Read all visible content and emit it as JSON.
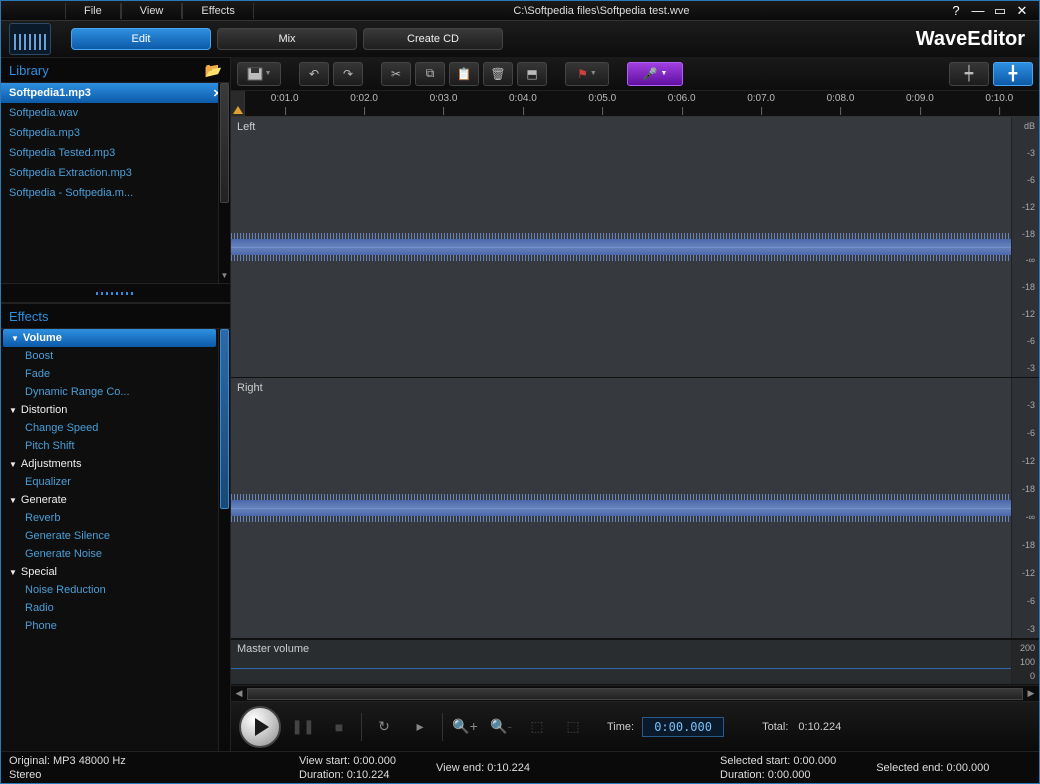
{
  "menubar": {
    "file": "File",
    "view": "View",
    "effects": "Effects",
    "title": "C:\\Softpedia files\\Softpedia test.wve"
  },
  "brand": "WaveEditor",
  "maintabs": {
    "edit": "Edit",
    "mix": "Mix",
    "create_cd": "Create CD"
  },
  "library": {
    "header": "Library",
    "items": [
      "Softpedia1.mp3",
      "Softpedia.wav",
      "Softpedia.mp3",
      "Softpedia Tested.mp3",
      "Softpedia Extraction.mp3",
      "Softpedia - Softpedia.m..."
    ]
  },
  "effects": {
    "header": "Effects",
    "tree": [
      {
        "cat": "Volume",
        "active": true,
        "children": [
          "Boost",
          "Fade",
          "Dynamic Range Co..."
        ]
      },
      {
        "cat": "Distortion",
        "children": [
          "Change Speed",
          "Pitch Shift"
        ]
      },
      {
        "cat": "Adjustments",
        "children": [
          "Equalizer"
        ]
      },
      {
        "cat": "Generate",
        "children": [
          "Reverb",
          "Generate Silence",
          "Generate Noise"
        ]
      },
      {
        "cat": "Special",
        "children": [
          "Noise Reduction",
          "Radio",
          "Phone"
        ]
      }
    ]
  },
  "ruler": {
    "ticks": [
      "0:01.0",
      "0:02.0",
      "0:03.0",
      "0:04.0",
      "0:05.0",
      "0:06.0",
      "0:07.0",
      "0:08.0",
      "0:09.0",
      "0:10.0"
    ]
  },
  "channels": {
    "left": "Left",
    "right": "Right",
    "db_header": "dB",
    "scale": [
      "-3",
      "-6",
      "-12",
      "-18",
      "-∞",
      "-18",
      "-12",
      "-6",
      "-3"
    ]
  },
  "master": {
    "label": "Master volume",
    "scale": [
      "200",
      "100",
      "0"
    ]
  },
  "transport": {
    "time_label": "Time:",
    "time_value": "0:00.000",
    "total_label": "Total:",
    "total_value": "0:10.224"
  },
  "status": {
    "original": "Original: MP3  48000 Hz",
    "stereo": "Stereo",
    "view_start": "View start: 0:00.000",
    "view_end": "View end: 0:10.224",
    "duration1": "Duration: 0:10.224",
    "sel_start": "Selected start: 0:00.000",
    "sel_end": "Selected end: 0:00.000",
    "duration2": "Duration: 0:00.000"
  }
}
